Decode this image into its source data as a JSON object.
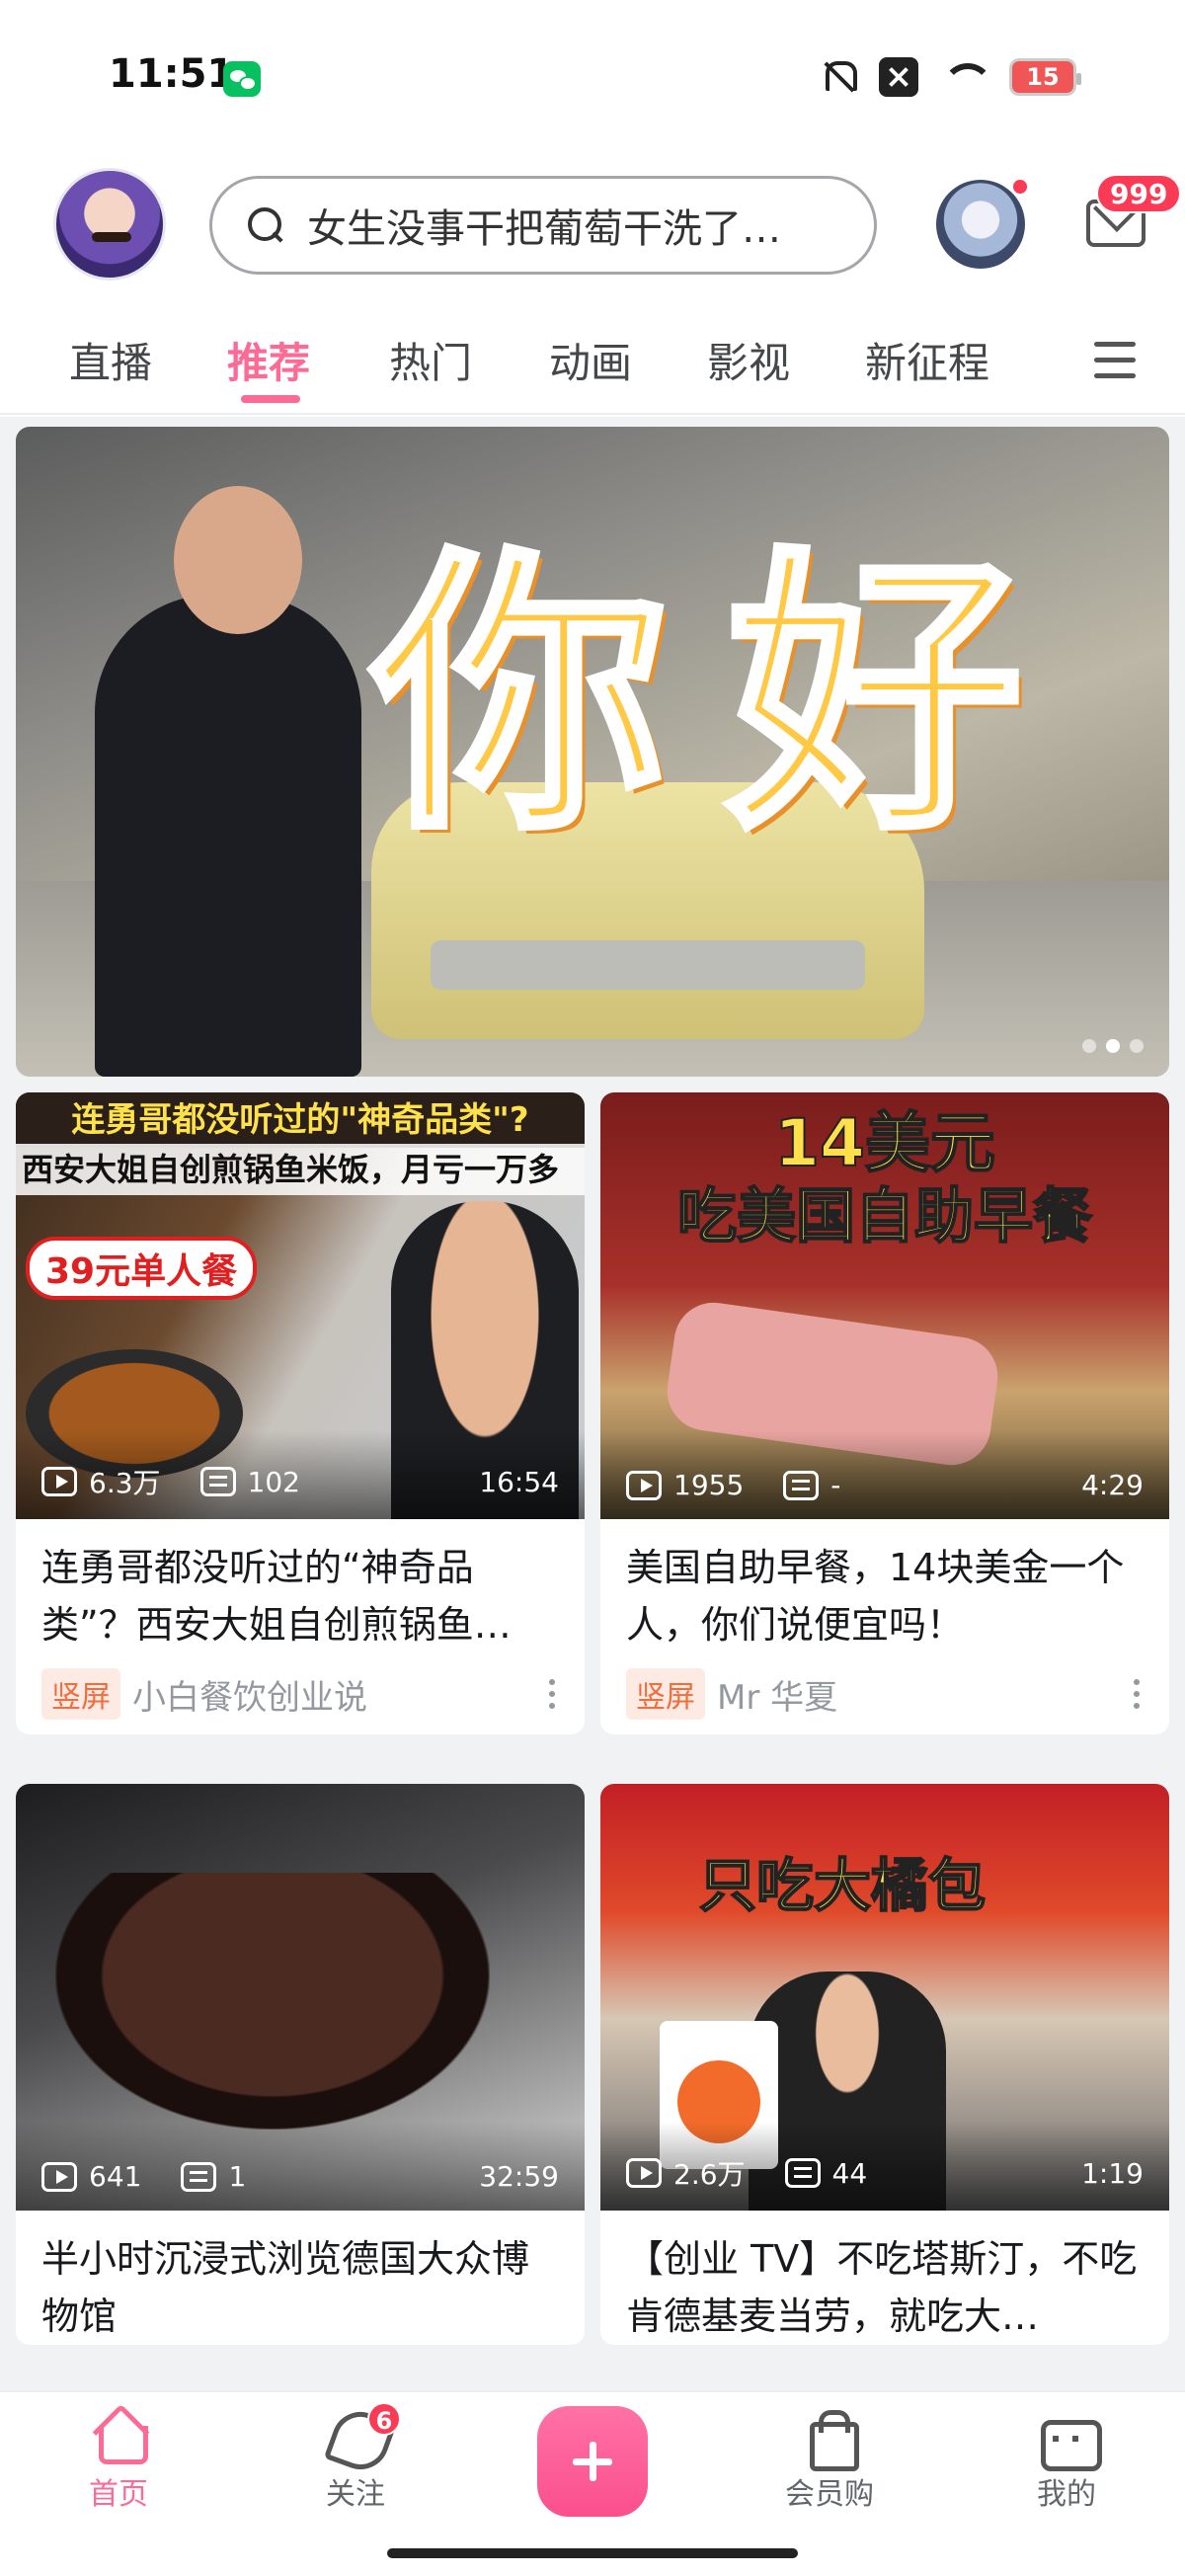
{
  "status_bar": {
    "time": "11:51",
    "battery": "15",
    "icons": [
      "wechat-icon",
      "bell-muted-icon",
      "close-box-icon",
      "wifi-icon",
      "battery-icon"
    ]
  },
  "header": {
    "search_placeholder": "女生没事干把葡萄干洗了…",
    "mail_badge": "999"
  },
  "tabs": [
    {
      "label": "直播"
    },
    {
      "label": "推荐",
      "active": true
    },
    {
      "label": "热门"
    },
    {
      "label": "动画"
    },
    {
      "label": "影视"
    },
    {
      "label": "新征程"
    }
  ],
  "banner": {
    "overlay_text": "你好",
    "page_indicator": {
      "count": 3,
      "active_index": 1
    }
  },
  "cards": [
    {
      "thumb_text_1": "连勇哥都没听过的\"神奇品类\"?",
      "thumb_text_2": "西安大姐自创煎锅鱼米饭，月亏一万多",
      "thumb_price": "39元单人餐",
      "views": "6.3万",
      "danmaku": "102",
      "duration": "16:54",
      "title": "连勇哥都没听过的“神奇品类”？西安大姐自创煎锅鱼…",
      "tag": "竖屏",
      "author": "小白餐饮创业说"
    },
    {
      "thumb_text_1": "14美元",
      "thumb_text_2": "吃美国自助早餐",
      "views": "1955",
      "danmaku": "-",
      "duration": "4:29",
      "title": "美国自助早餐，14块美金一个人，你们说便宜吗！",
      "tag": "竖屏",
      "author": "Mr 华夏"
    },
    {
      "views": "641",
      "danmaku": "1",
      "duration": "32:59",
      "title": "半小时沉浸式浏览德国大众博物馆"
    },
    {
      "thumb_text_1": "只吃大橘包",
      "views": "2.6万",
      "danmaku": "44",
      "duration": "1:19",
      "title": "【创业 TV】不吃塔斯汀，不吃肯德基麦当劳，就吃大…"
    }
  ],
  "bottom_nav": {
    "items": [
      {
        "label": "首页",
        "active": true
      },
      {
        "label": "关注",
        "badge": "6"
      },
      {
        "label": "会员购"
      },
      {
        "label": "我的"
      }
    ]
  },
  "colors": {
    "accent": "#fb6b96",
    "badge_red": "#fb3a56",
    "tag_orange": "#f26d3d"
  }
}
